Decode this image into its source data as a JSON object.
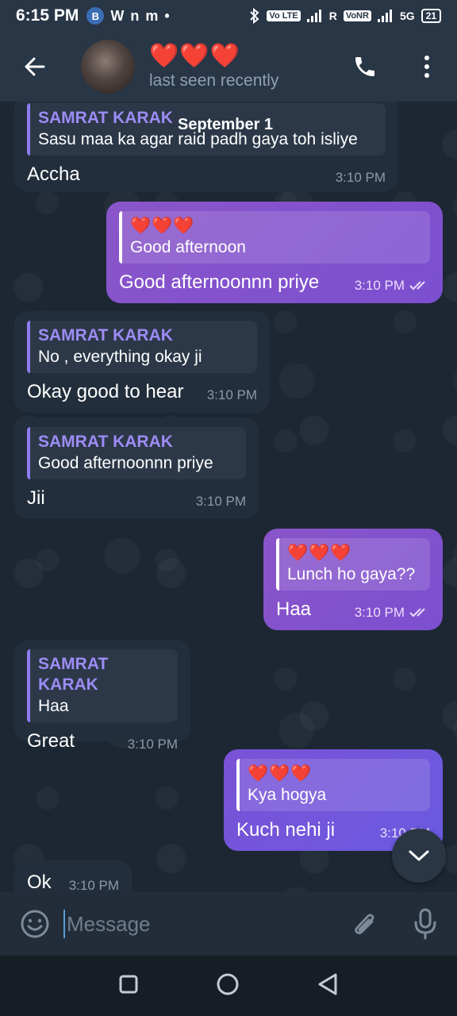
{
  "status_bar": {
    "time": "6:15 PM",
    "left_icons": [
      "B",
      "W",
      "n",
      "m",
      "•"
    ],
    "volte_badge": "Vo LTE",
    "roaming": "R",
    "vonr_badge": "VoNR",
    "network": "5G",
    "battery": "21"
  },
  "header": {
    "title": "❤️❤️❤️",
    "subtitle": "last seen recently"
  },
  "date_label": "September 1",
  "messages": [
    {
      "reply_name": "SAMRAT KARAK",
      "reply_text": "Sasu maa ka agar raid padh gaya toh isliye",
      "text": "Accha",
      "time": "3:10 PM"
    },
    {
      "reply_name": "❤️❤️❤️",
      "reply_text": "Good afternoon",
      "text": "Good afternoonnn priye",
      "time": "3:10 PM"
    },
    {
      "reply_name": "SAMRAT KARAK",
      "reply_text": "No , everything okay ji",
      "text": "Okay good to hear",
      "time": "3:10 PM"
    },
    {
      "reply_name": "SAMRAT KARAK",
      "reply_text": "Good afternoonnn priye",
      "text": "Jii",
      "time": "3:10 PM"
    },
    {
      "reply_name": "❤️❤️❤️",
      "reply_text": "Lunch ho gaya??",
      "text": "Haa",
      "time": "3:10 PM"
    },
    {
      "reply_name": "SAMRAT KARAK",
      "reply_text": "Haa",
      "text": "Great",
      "time": "3:10 PM"
    },
    {
      "reply_name": "❤️❤️❤️",
      "reply_text": "Kya hogya",
      "text": "Kuch nehi ji",
      "time": "3:10 PM"
    },
    {
      "text": "Ok",
      "time": "3:10 PM"
    }
  ],
  "input": {
    "placeholder": "Message"
  },
  "icons": {
    "back": "arrow-left-icon",
    "call": "phone-icon",
    "menu": "more-vertical-icon",
    "emoji": "emoji-icon",
    "attach": "paperclip-icon",
    "mic": "microphone-icon",
    "scroll_down": "chevron-down-icon"
  },
  "colors": {
    "header_bg": "#283646",
    "chat_bg": "#1d2733",
    "incoming_bubble": "#222e3b",
    "outgoing_bubble": "#8a55c9",
    "reply_name": "#9d8cf5"
  }
}
